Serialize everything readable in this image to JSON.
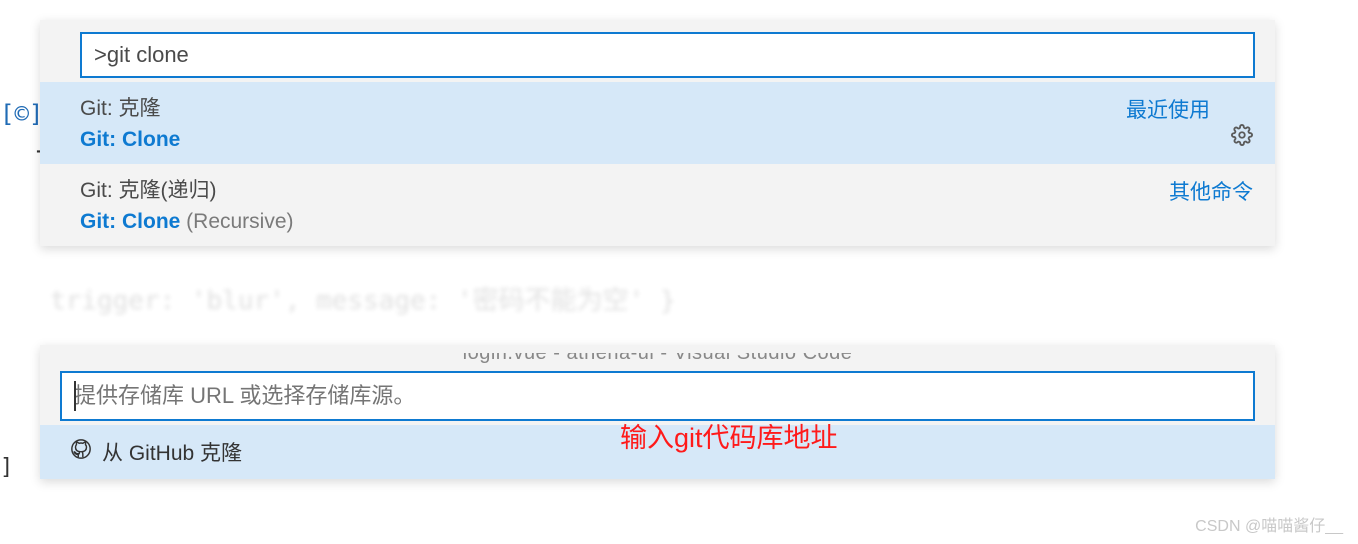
{
  "palette": {
    "input_value": ">git clone",
    "items": [
      {
        "title": "Git: 克隆",
        "cmd": "Git: Clone",
        "param": "",
        "side_label": "最近使用",
        "has_gear": true,
        "selected": true
      },
      {
        "title": "Git: 克隆(递归)",
        "cmd": "Git: Clone",
        "param": " (Recursive)",
        "side_label": "其他命令",
        "has_gear": false,
        "selected": false
      }
    ]
  },
  "url_panel": {
    "window_title": "login.vue - athena-ui - Visual Studio Code",
    "placeholder": "提供存储库 URL 或选择存储库源。",
    "option_label": "从 GitHub 克隆"
  },
  "annotation": "输入git代码库地址",
  "watermark": "CSDN @喵喵酱仔__",
  "background_fragments": {
    "left_bracket": "[©]",
    "letter_t": "t",
    "code_line": "trigger: 'blur', message: '密码不能为空' }",
    "side2": "]"
  }
}
